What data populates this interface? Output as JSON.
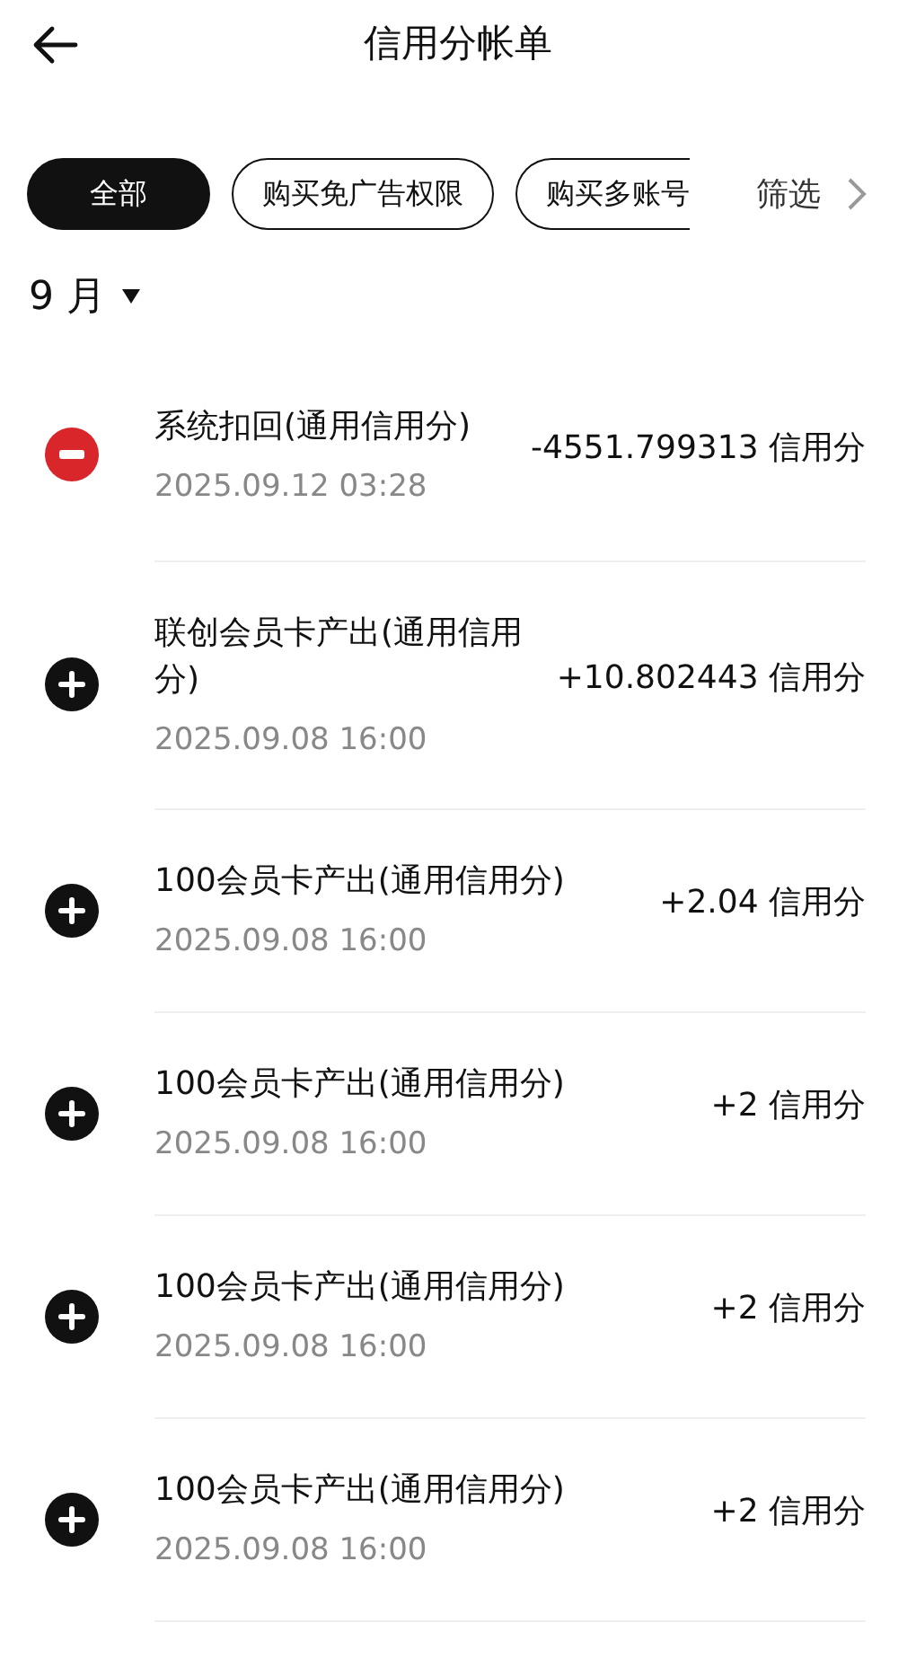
{
  "header": {
    "title": "信用分帐单"
  },
  "chips": [
    {
      "label": "全部",
      "selected": true
    },
    {
      "label": "购买免广告权限",
      "selected": false
    },
    {
      "label": "购买多账号",
      "selected": false
    }
  ],
  "filter": {
    "label": "筛选"
  },
  "month": {
    "label": "9 月"
  },
  "records": [
    {
      "kind": "debit",
      "title": "系统扣回(通用信用分)",
      "time": "2025.09.12 03:28",
      "amount": "-4551.799313 信用分"
    },
    {
      "kind": "credit",
      "title": "联创会员卡产出(通用信用分)",
      "time": "2025.09.08 16:00",
      "amount": "+10.802443 信用分"
    },
    {
      "kind": "credit",
      "title": "100会员卡产出(通用信用分)",
      "time": "2025.09.08 16:00",
      "amount": "+2.04 信用分"
    },
    {
      "kind": "credit",
      "title": "100会员卡产出(通用信用分)",
      "time": "2025.09.08 16:00",
      "amount": "+2 信用分"
    },
    {
      "kind": "credit",
      "title": "100会员卡产出(通用信用分)",
      "time": "2025.09.08 16:00",
      "amount": "+2 信用分"
    },
    {
      "kind": "credit",
      "title": "100会员卡产出(通用信用分)",
      "time": "2025.09.08 16:00",
      "amount": "+2 信用分"
    }
  ]
}
